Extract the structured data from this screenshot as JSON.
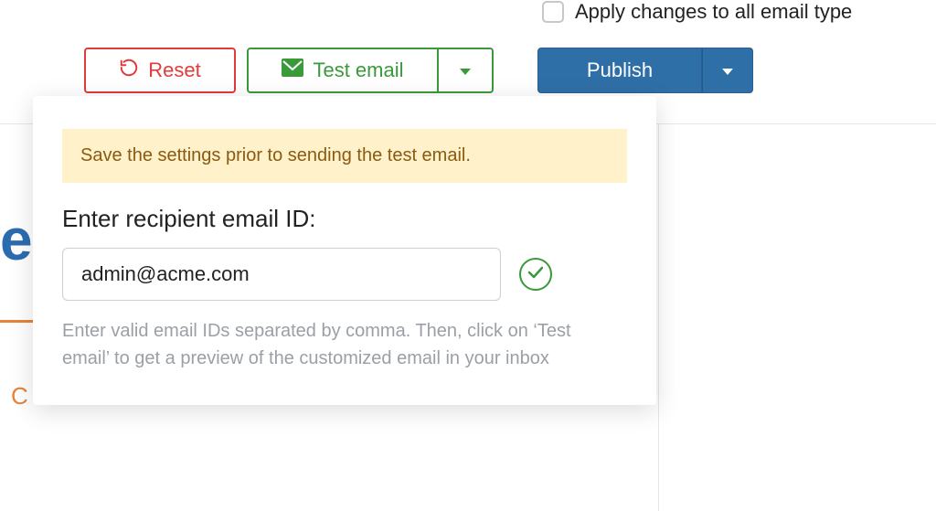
{
  "checkbox": {
    "label": "Apply changes to all email type"
  },
  "toolbar": {
    "reset_label": "Reset",
    "test_label": "Test email",
    "publish_label": "Publish"
  },
  "popover": {
    "warning": "Save the settings prior to sending the test email.",
    "prompt": "Enter recipient email ID:",
    "email_value": "admin@acme.com",
    "helper": "Enter valid email IDs separated by comma. Then, click on ‘Test email’ to get a preview of the customized email in your inbox"
  },
  "background": {
    "blue_fragment": "e",
    "orange_char": "C"
  }
}
